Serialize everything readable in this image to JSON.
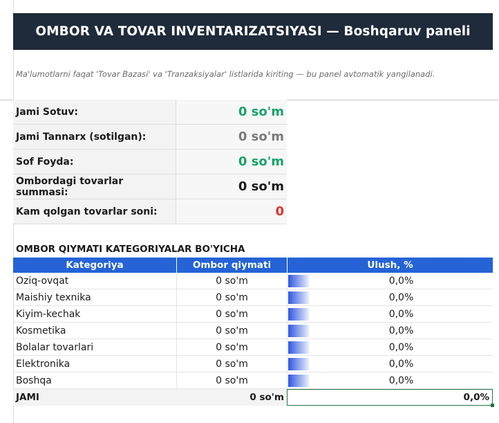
{
  "header": {
    "title": "OMBOR VA TOVAR INVENTARIZATSIYASI — Boshqaruv paneli"
  },
  "note": "Ma'lumotlarni faqat 'Tovar Bazasi' va 'Tranzaksiyalar' listlarida kiriting — bu panel avtomatik yangilanadi.",
  "kpis": [
    {
      "label": "Jami Sotuv:",
      "value": "0 so'm",
      "color": "#1aa36b"
    },
    {
      "label": "Jami Tannarx (sotilgan):",
      "value": "0 so'm",
      "color": "#7a7a7a"
    },
    {
      "label": "Sof Foyda:",
      "value": "0 so'm",
      "color": "#1aa36b"
    },
    {
      "label": "Ombordagi tovarlar summasi:",
      "value": "0 so'm",
      "color": "#1b1b1b"
    },
    {
      "label": "Kam qolgan tovarlar soni:",
      "value": "0",
      "color": "#e03131"
    }
  ],
  "section_title": "OMBOR QIYMATI KATEGORIYALAR BO'YICHA",
  "table": {
    "headers": [
      "Kategoriya",
      "Ombor qiymati",
      "Ulush, %"
    ],
    "header_color": "#2563d6",
    "rows": [
      {
        "category": "Oziq-ovqat",
        "value": "0 so'm",
        "share": "0,0%"
      },
      {
        "category": "Maishiy texnika",
        "value": "0 so'm",
        "share": "0,0%"
      },
      {
        "category": "Kiyim-kechak",
        "value": "0 so'm",
        "share": "0,0%"
      },
      {
        "category": "Kosmetika",
        "value": "0 so'm",
        "share": "0,0%"
      },
      {
        "category": "Bolalar tovarlari",
        "value": "0 so'm",
        "share": "0,0%"
      },
      {
        "category": "Elektronika",
        "value": "0 so'm",
        "share": "0,0%"
      },
      {
        "category": "Boshqa",
        "value": "0 so'm",
        "share": "0,0%"
      }
    ],
    "total": {
      "label": "JAMI",
      "value": "0 so'm",
      "share": "0,0%"
    }
  }
}
